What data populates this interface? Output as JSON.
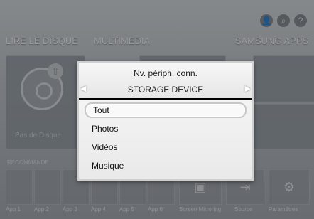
{
  "top_bar": {
    "icons": [
      {
        "name": "user-icon",
        "glyph": "👤"
      },
      {
        "name": "search-icon",
        "glyph": "⌕"
      },
      {
        "name": "help-icon",
        "glyph": "?"
      }
    ]
  },
  "sections": {
    "disc": "LIRE LE DISQUE",
    "multimedia": "MULTIMEDIA",
    "apps": "SAMSUNG APPS"
  },
  "disc_tile": {
    "label": "Pas de Disque"
  },
  "recommended_label": "RECOMMANDE",
  "apps_row": {
    "apps": [
      "App 1",
      "App 2",
      "App 3",
      "App 4",
      "App 5",
      "App 6"
    ],
    "screen_mirroring": "Screen Mirroring",
    "source": "Source",
    "settings": "Paramètres"
  },
  "dialog": {
    "title": "Nv. périph. conn.",
    "device": "STORAGE DEVICE",
    "items": [
      "Tout",
      "Photos",
      "Vidéos",
      "Musique"
    ],
    "selected_index": 0
  },
  "colors": {
    "dialog_header": "#efefef",
    "dialog_list": "#f1f1f1",
    "background_dim": "#7f8387"
  }
}
